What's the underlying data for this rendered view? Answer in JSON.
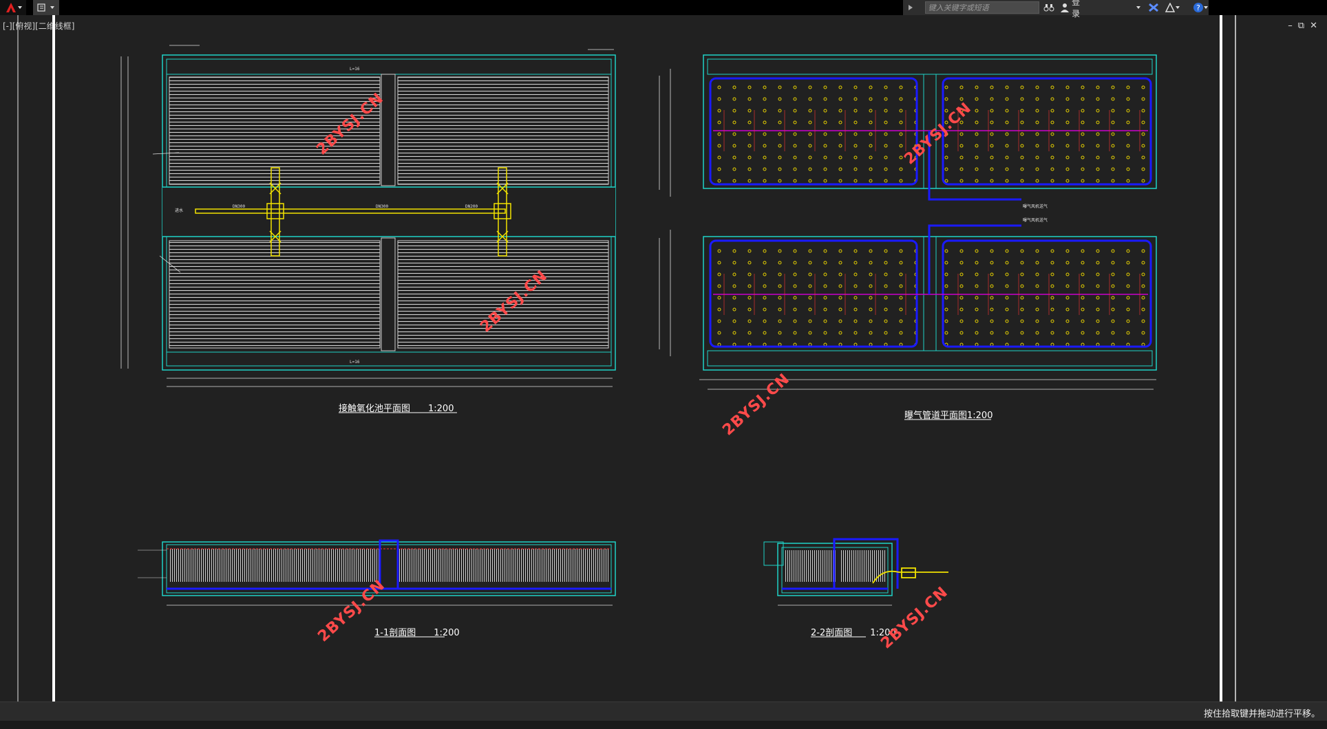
{
  "infocenter": {
    "search_placeholder": "键入关键字或短语",
    "login_label": "登录"
  },
  "viewport": {
    "label": "[-][俯视][二维线框]"
  },
  "drawing": {
    "plan1_title": "接触氧化池平面图　　1:200",
    "plan2_title": "曝气管道平面图1:200",
    "section1_title": "1-1剖面图　　1:200",
    "section2_title": "2-2剖面图　　1:200",
    "watermark": "2BYSJ.CN"
  },
  "status": {
    "message": "按住拾取键并拖动进行平移。"
  },
  "colors": {
    "background": "#212121",
    "cyan": "#1fd3c7",
    "yellow": "#f2e300",
    "blue": "#1a1aff",
    "magenta": "#cc00cc",
    "watermark": "#ff4a4a"
  }
}
